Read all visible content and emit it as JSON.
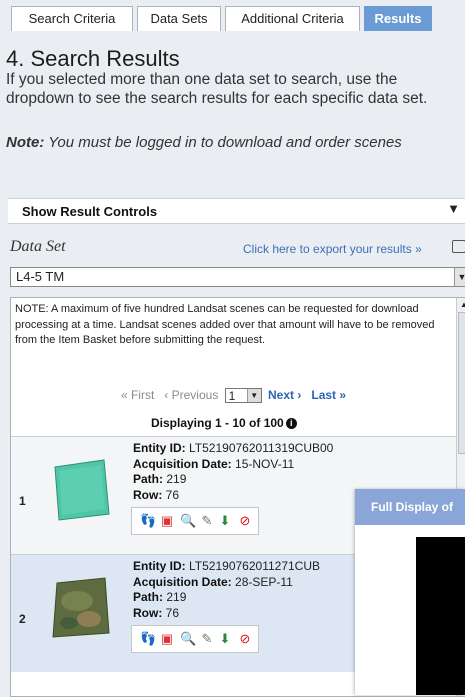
{
  "tabs": [
    {
      "label": "Search Criteria"
    },
    {
      "label": "Data Sets"
    },
    {
      "label": "Additional Criteria"
    },
    {
      "label": "Results",
      "active": true
    }
  ],
  "page": {
    "title": "4. Search Results",
    "intro": "If you selected more than one data set to search, use the dropdown to see the search results for each specific data set.",
    "note_label": "Note:",
    "note_text": " You must be logged in to download and order scenes"
  },
  "result_controls": {
    "label": "Show Result Controls"
  },
  "dataset": {
    "label": "Data Set",
    "export_link": "Click here to export your results »",
    "selected": "L4-5 TM"
  },
  "results": {
    "notice": "NOTE: A maximum of five hundred Landsat scenes can be requested for download processing at a time. Landsat scenes added over that amount will have to be removed from the Item Basket before submitting the request.",
    "pager": {
      "first": "« First",
      "previous": "‹ Previous",
      "page": "1",
      "next": "Next ›",
      "last": "Last »"
    },
    "displaying": "Displaying 1 - 10 of 100",
    "items": [
      {
        "num": "1",
        "entity_label": "Entity ID:",
        "entity_id": "LT52190762011319CUB00",
        "date_label": "Acquisition Date:",
        "date": "15-NOV-11",
        "path_label": "Path:",
        "path": "219",
        "row_label": "Row:",
        "row": "76"
      },
      {
        "num": "2",
        "entity_label": "Entity ID:",
        "entity_id": "LT52190762011271CUB",
        "date_label": "Acquisition Date:",
        "date": "28-SEP-11",
        "path_label": "Path:",
        "path": "219",
        "row_label": "Row:",
        "row": "76"
      }
    ],
    "action_icons": [
      "footprint-icon",
      "metadata-icon",
      "compare-icon",
      "order-icon",
      "download-icon",
      "exclude-icon"
    ]
  },
  "overlay": {
    "header": "Full Display of"
  },
  "colors": {
    "active_tab": "#6b9bd4",
    "link": "#2e63b5",
    "overlay_header": "#8aa6d9",
    "row_highlight": "#dde7f3"
  }
}
